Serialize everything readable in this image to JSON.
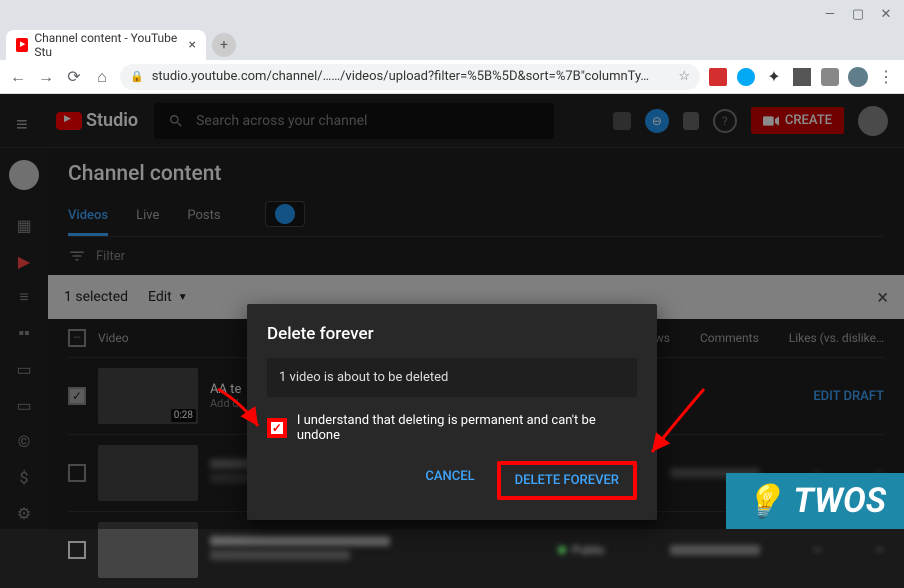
{
  "browser": {
    "tab_title": "Channel content - YouTube Stu",
    "url": "studio.youtube.com/channel/……/videos/upload?filter=%5B%5D&sort=%7B\"columnTy…"
  },
  "app": {
    "logo": "Studio",
    "search_placeholder": "Search across your channel",
    "create_label": "CREATE"
  },
  "page": {
    "title": "Channel content",
    "tabs": {
      "videos": "Videos",
      "live": "Live",
      "posts": "Posts"
    },
    "filter_label": "Filter",
    "selection": {
      "count_text": "1 selected",
      "edit_label": "Edit"
    },
    "table": {
      "header": {
        "video": "Video",
        "views": "Views",
        "comments": "Comments",
        "likes": "Likes (vs. dislike…"
      },
      "rows": [
        {
          "title": "AA te",
          "subtitle": "Add d",
          "duration": "0:28",
          "action": "EDIT DRAFT"
        }
      ]
    }
  },
  "modal": {
    "title": "Delete forever",
    "message": "1 video is about to be deleted",
    "checkbox_label": "I understand that deleting is permanent and can't be undone",
    "cancel": "CANCEL",
    "confirm": "DELETE FOREVER"
  },
  "watermark": "TWOS"
}
